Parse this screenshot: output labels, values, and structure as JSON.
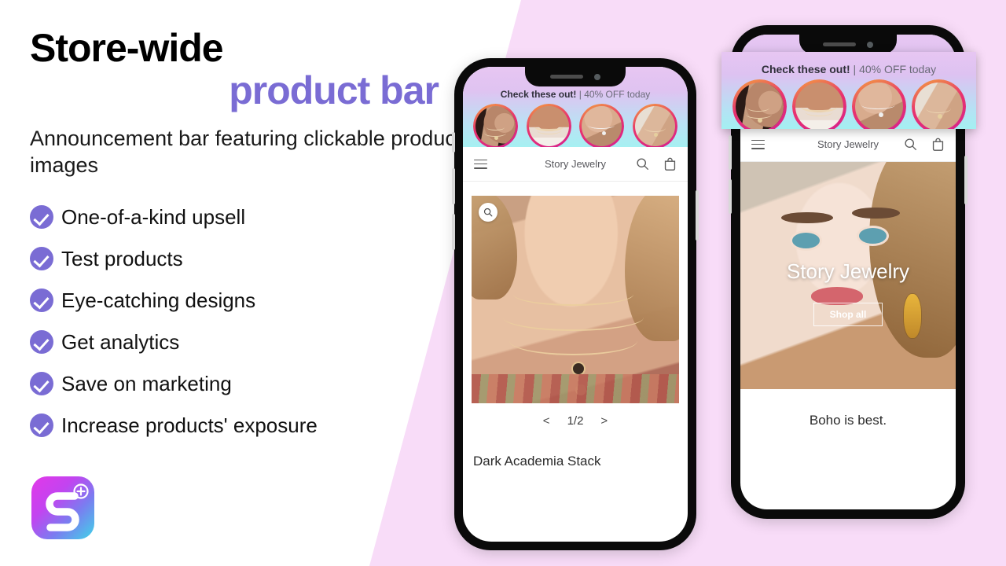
{
  "promo": {
    "headline_line1": "Store-wide",
    "headline_line2": "product bar",
    "subtitle": "Announcement bar featuring clickable product images",
    "accent_color": "#7a6cd4",
    "background_color": "#f8dcf8",
    "features": [
      {
        "label": "One-of-a-kind upsell"
      },
      {
        "label": "Test products"
      },
      {
        "label": "Eye-catching designs"
      },
      {
        "label": "Get analytics"
      },
      {
        "label": "Save on marketing"
      },
      {
        "label": "Increase products' exposure"
      }
    ],
    "logo": {
      "name": "app-logo",
      "glyph": "S",
      "badge": "+"
    }
  },
  "announcement_bar": {
    "message_strong": "Check these out!",
    "message_rest": " | 40% OFF today",
    "gradient_from": "#e7c6f2",
    "gradient_to": "#a6f0f2",
    "ring_color": "#d6228f",
    "thumbnails": [
      {
        "alt": "Layered gold chain necklace on dark-haired model"
      },
      {
        "alt": "Beaded statement collar necklace"
      },
      {
        "alt": "Delicate silver pendant necklace"
      },
      {
        "alt": "Fine gold pendant with white scarf"
      }
    ]
  },
  "phone_left": {
    "store_header": {
      "menu_icon": "hamburger-icon",
      "title": "Story Jewelry",
      "search_icon": "search-icon",
      "cart_icon": "shopping-bag-icon"
    },
    "product_view": {
      "zoom_icon": "magnifier-icon",
      "image_alt": "Close-up of layered gold coin necklaces on neck",
      "prev_label": "<",
      "page_indicator": "1/2",
      "next_label": ">",
      "product_name": "Dark Academia Stack"
    }
  },
  "phone_right": {
    "store_header": {
      "menu_icon": "hamburger-icon",
      "title": "Story Jewelry",
      "search_icon": "search-icon",
      "cart_icon": "shopping-bag-icon"
    },
    "hero": {
      "title": "Story Jewelry",
      "cta_label": "Shop all",
      "image_alt": "Model wearing ornate gold statement earring"
    },
    "tagline": "Boho is best."
  }
}
